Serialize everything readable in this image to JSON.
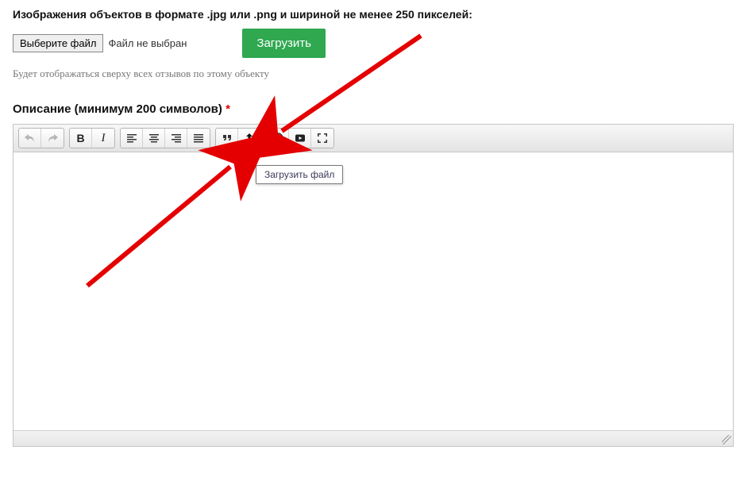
{
  "imageUpload": {
    "label": "Изображения объектов в формате .jpg или .png и шириной не менее 250 пикселей:",
    "fileButton": "Выберите файл",
    "fileStatus": "Файл не выбран",
    "uploadButton": "Загрузить",
    "hint": "Будет отображаться сверху всех отзывов по этому объекту"
  },
  "description": {
    "label": "Описание (минимум 200 символов)",
    "requiredMark": "*"
  },
  "tooltip": "Загрузить файл",
  "toolbar": {
    "undo": "undo",
    "redo": "redo",
    "bold": "B",
    "italic": "I"
  }
}
